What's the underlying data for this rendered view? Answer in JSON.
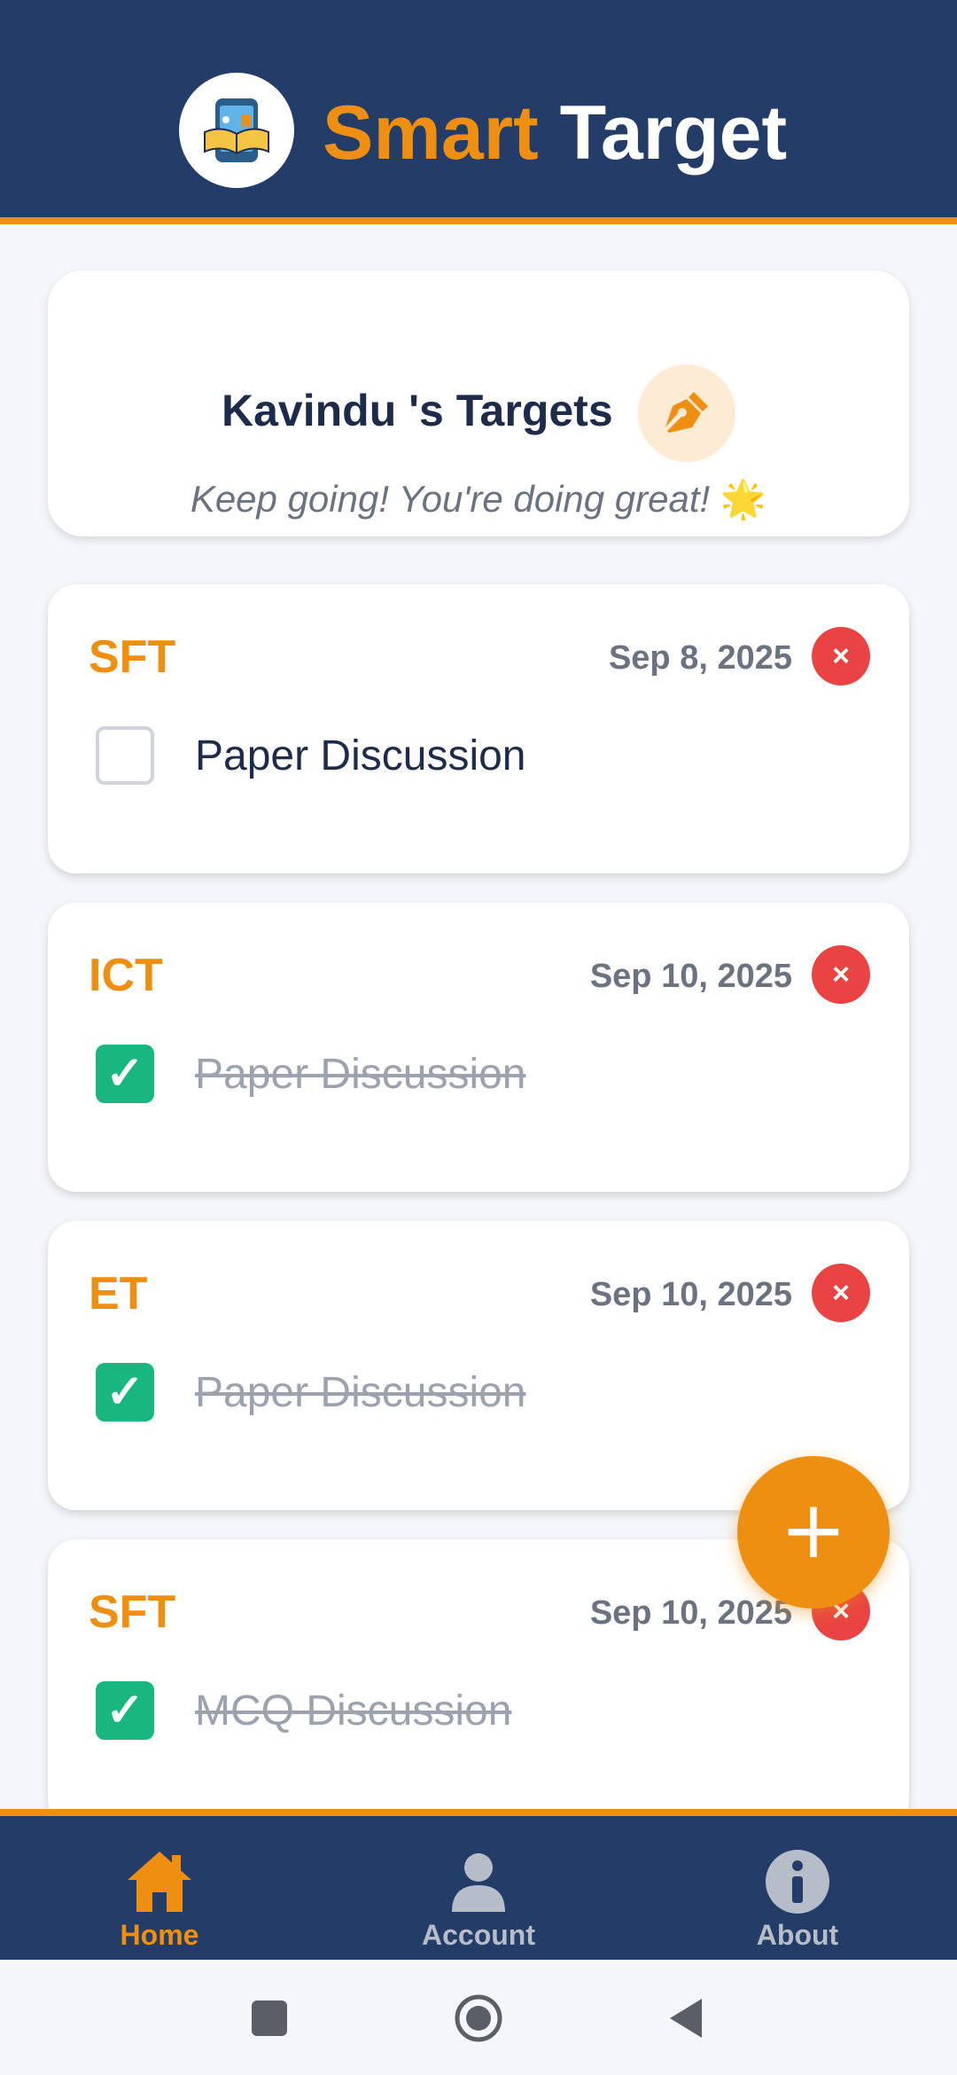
{
  "app": {
    "title_part1": "Smart",
    "title_part2": "Target"
  },
  "greeting": {
    "title": "Kavindu 's Targets",
    "subtitle": "Keep going! You're doing great!",
    "emoji": "🌟"
  },
  "tasks": [
    {
      "subject": "SFT",
      "date": "Sep 8, 2025",
      "text": "Paper Discussion",
      "done": false
    },
    {
      "subject": "ICT",
      "date": "Sep 10, 2025",
      "text": "Paper Discussion",
      "done": true
    },
    {
      "subject": "ET",
      "date": "Sep 10, 2025",
      "text": "Paper Discussion",
      "done": true
    },
    {
      "subject": "SFT",
      "date": "Sep 10, 2025",
      "text": "MCQ Discussion",
      "done": true
    }
  ],
  "delete_symbol": "×",
  "check_symbol": "✓",
  "fab_symbol": "+",
  "nav": [
    {
      "label": "Home",
      "icon": "home-icon",
      "active": true
    },
    {
      "label": "Account",
      "icon": "user-icon",
      "active": false
    },
    {
      "label": "About",
      "icon": "info-icon",
      "active": false
    }
  ],
  "colors": {
    "primary": "#243d68",
    "accent": "#ef8f12",
    "danger": "#e94343",
    "success": "#19b77f"
  }
}
